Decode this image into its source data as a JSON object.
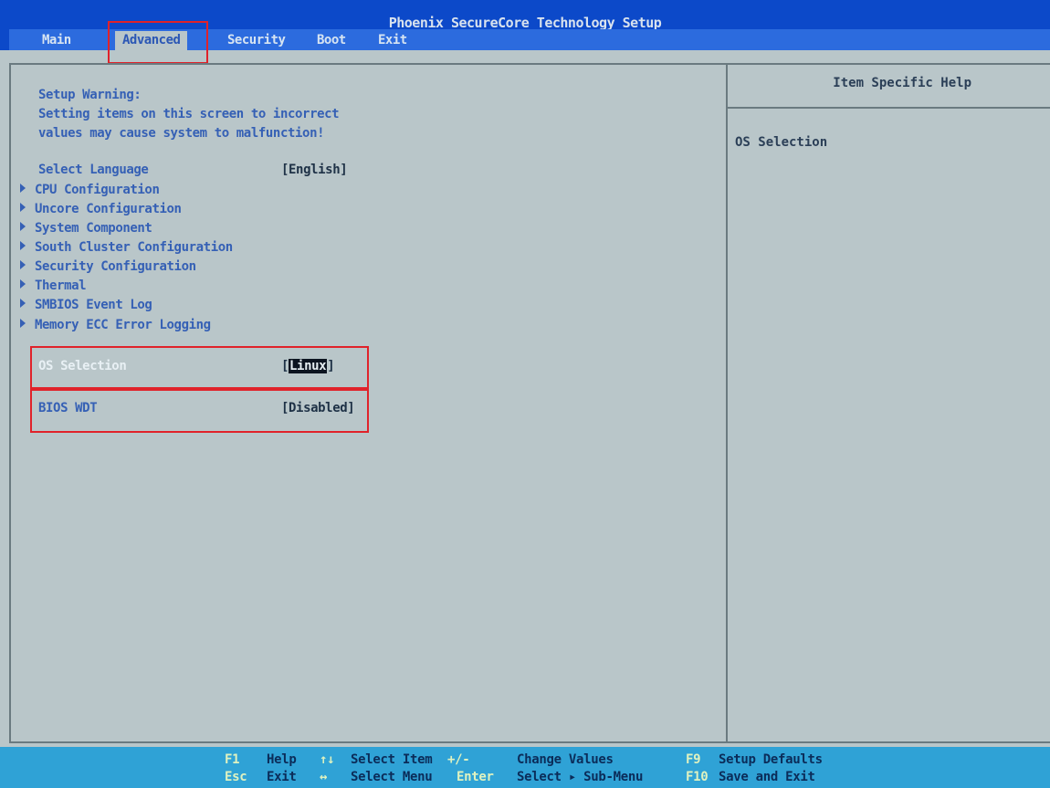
{
  "title": "Phoenix SecureCore Technology Setup",
  "tabs": [
    {
      "label": "Main"
    },
    {
      "label": "Advanced"
    },
    {
      "label": "Security"
    },
    {
      "label": "Boot"
    },
    {
      "label": "Exit"
    }
  ],
  "active_tab": "Advanced",
  "warning": [
    "Setup Warning:",
    "Setting items on this screen to incorrect",
    "values may cause system to malfunction!"
  ],
  "language": {
    "label": "Select Language",
    "value": "[English]"
  },
  "submenus": [
    "CPU Configuration",
    "Uncore Configuration",
    "System Component",
    "South Cluster Configuration",
    "Security Configuration",
    "Thermal",
    "SMBIOS Event Log",
    "Memory ECC Error Logging"
  ],
  "os_selection": {
    "label": "OS Selection",
    "open": "[",
    "value": "Linux",
    "close": "]"
  },
  "bios_wdt": {
    "label": "BIOS WDT",
    "value": "[Disabled]"
  },
  "help": {
    "heading": "Item Specific Help",
    "text": "OS Selection"
  },
  "footer": [
    {
      "key": "F1",
      "desc": "Help"
    },
    {
      "key": "↑↓",
      "desc": "Select Item"
    },
    {
      "key": "+/-",
      "desc": "Change Values"
    },
    {
      "key": "F9",
      "desc": "Setup Defaults"
    },
    {
      "key": "Esc",
      "desc": "Exit"
    },
    {
      "key": "↔",
      "desc": "Select Menu"
    },
    {
      "key": "Enter",
      "desc": "Select ▸ Sub-Menu"
    },
    {
      "key": "F10",
      "desc": "Save and Exit"
    }
  ],
  "colors": {
    "header": "#0c49c9",
    "footer": "#2fa2d6",
    "panel": "#b9c6c9",
    "annotation": "#e0222a"
  }
}
